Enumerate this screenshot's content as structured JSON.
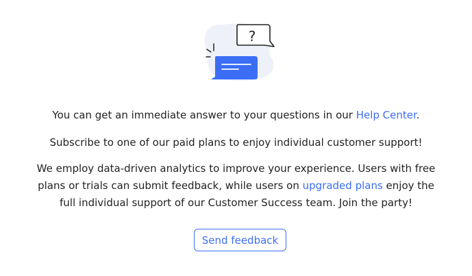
{
  "illustration": {
    "icon": "chat-bubbles-question-icon",
    "question_mark": "?",
    "colors": {
      "blob": "#eef1f8",
      "bubble": "#3b6ef5",
      "outline": "#222222"
    }
  },
  "help": {
    "prefix": "You can get an immediate answer to your questions in our ",
    "link": "Help Center",
    "suffix": "."
  },
  "subscribe_text": "Subscribe to one of our paid plans to enjoy individual customer support!",
  "analytics": {
    "prefix": "We employ data-driven analytics to improve your experience. Users with free plans or trials can submit feedback, while users on ",
    "link": "upgraded plans",
    "suffix": " enjoy the full individual support of our Customer Success team. Join the party!"
  },
  "send_feedback_label": "Send feedback",
  "colors": {
    "accent": "#3b6ef5",
    "text": "#222222"
  }
}
